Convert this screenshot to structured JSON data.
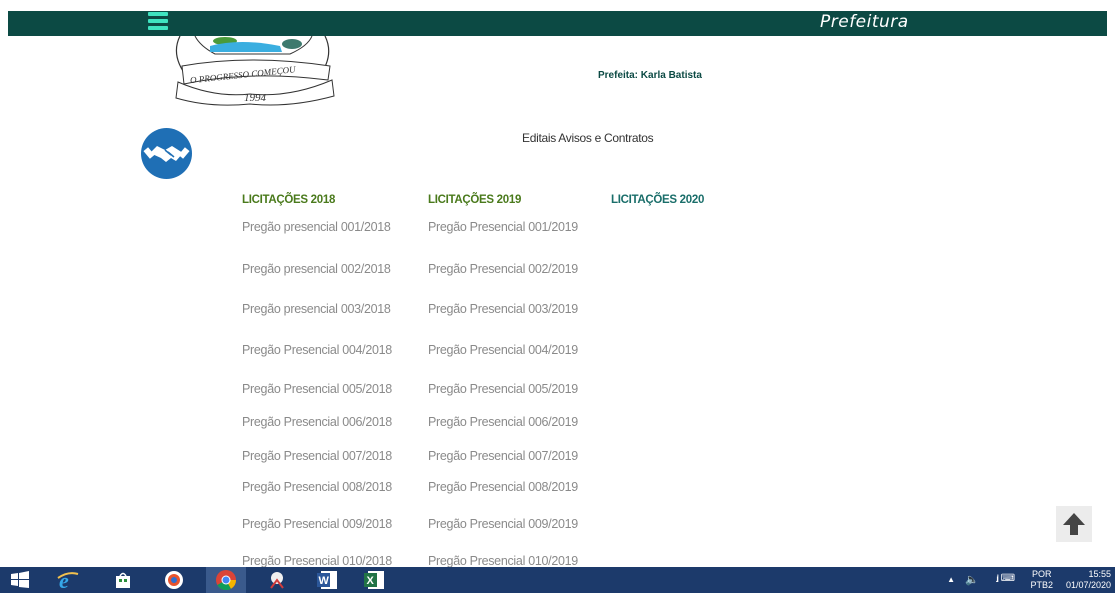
{
  "header": {
    "brand": "Prefeitura",
    "menu_icon": "hamburger-icon",
    "colors": {
      "bar": "#0c4a44",
      "menu_icon": "#3fe3c0"
    }
  },
  "logo": {
    "motto": "O PROGRESSO COMEÇOU",
    "year": "1994"
  },
  "mayor": "Prefeita: Karla Batista",
  "section": {
    "icon": "handshake-icon",
    "title": "Editais Avisos e Contratos"
  },
  "columns": [
    {
      "heading": "LICITAÇÕES 2018",
      "heading_color": "#4a7a1c",
      "items": [
        "Pregão presencial 001/2018",
        "Pregão presencial 002/2018",
        "Pregão presencial 003/2018",
        "Pregão Presencial 004/2018",
        "Pregão Presencial 005/2018",
        "Pregão Presencial 006/2018",
        "Pregão Presencial 007/2018",
        "Pregão Presencial 008/2018",
        "Pregão Presencial 009/2018",
        "Pregão Presencial 010/2018"
      ]
    },
    {
      "heading": "LICITAÇÕES 2019",
      "heading_color": "#4a7a1c",
      "items": [
        "Pregão Presencial 001/2019",
        "Pregão Presencial 002/2019",
        "Pregão Presencial 003/2019",
        "Pregão Presencial 004/2019",
        "Pregão Presencial 005/2019",
        "Pregão Presencial 006/2019",
        "Pregão Presencial 007/2019",
        "Pregão Presencial 008/2019",
        "Pregão Presencial 009/2019",
        "Pregão Presencial 010/2019"
      ]
    },
    {
      "heading": "LICITAÇÕES 2020",
      "heading_color": "#1a6e6a",
      "items": []
    }
  ],
  "scroll_top_icon": "arrow-up-icon",
  "taskbar": {
    "apps": [
      "windows-start-icon",
      "internet-explorer-icon",
      "store-icon",
      "app-icon",
      "chrome-icon",
      "snipping-tool-icon",
      "word-icon",
      "excel-icon"
    ],
    "tray": {
      "language": "POR",
      "keyboard": "PTB2",
      "time": "15:55",
      "date": "01/07/2020"
    }
  }
}
